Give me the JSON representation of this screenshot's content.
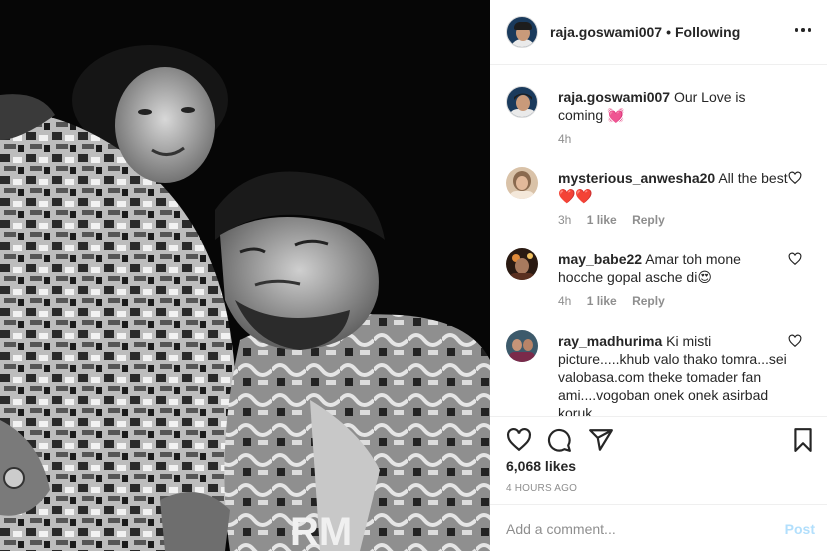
{
  "header": {
    "username": "raja.goswami007",
    "separator": "•",
    "follow_status": "Following"
  },
  "caption": {
    "username": "raja.goswami007",
    "text": "Our Love is coming 💓",
    "time": "4h"
  },
  "comments": [
    {
      "username": "mysterious_anwesha20",
      "text": "All the best❤️❤️",
      "time": "3h",
      "likes": "1 like",
      "reply": "Reply"
    },
    {
      "username": "may_babe22",
      "text": "Amar toh mone hocche gopal asche di😍",
      "time": "4h",
      "likes": "1 like",
      "reply": "Reply"
    },
    {
      "username": "ray_madhurima",
      "text": "Ki misti picture.....khub valo thako tomra...sei valobasa.com theke tomader fan ami....vogoban onek onek asirbad koruk"
    }
  ],
  "actions": {
    "likes": "6,068 likes",
    "timestamp": "4 HOURS AGO"
  },
  "add_comment": {
    "placeholder": "Add a comment...",
    "post_label": "Post"
  },
  "icons": {
    "more": "more-options-icon",
    "like": "heart-icon",
    "comment": "comment-icon",
    "share": "share-icon",
    "save": "bookmark-icon",
    "comment_like": "small-heart-icon"
  }
}
